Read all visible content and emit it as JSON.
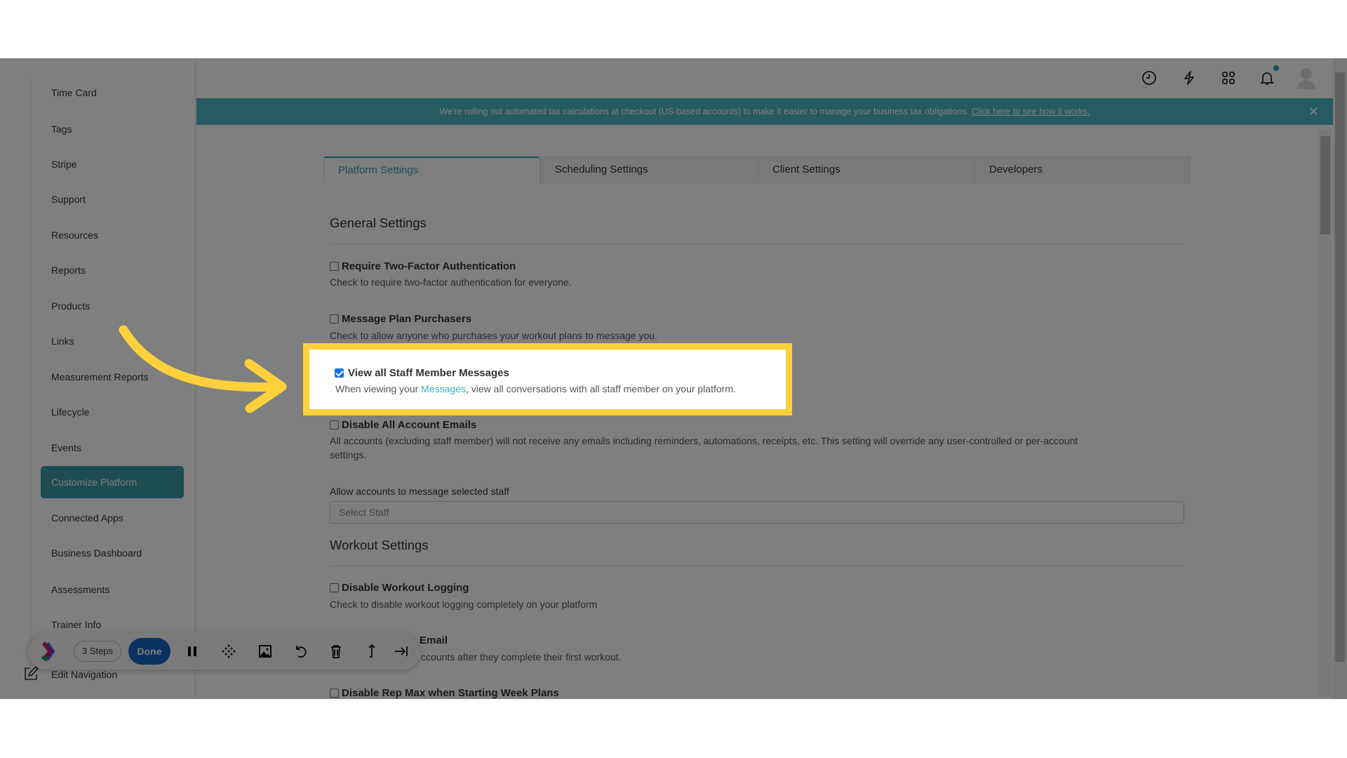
{
  "sidebar": {
    "items": [
      "Time Card",
      "Tags",
      "Stripe",
      "Support",
      "Resources",
      "Reports",
      "Products",
      "Links",
      "Measurement Reports",
      "Lifecycle",
      "Events",
      "Customize Platform",
      "Connected Apps",
      "Business Dashboard",
      "Assessments",
      "Trainer Info"
    ],
    "active": "Customize Platform",
    "edit_navigation": "Edit Navigation"
  },
  "header": {
    "icons": [
      "clock-icon",
      "bolt-icon",
      "apps-grid-icon",
      "bell-icon",
      "avatar"
    ],
    "notification_dot_color": "#2a9fb3"
  },
  "banner": {
    "text": "We're rolling out automated tax calculations at checkout (US-based accounts) to make it easier to manage your business tax obligations. ",
    "link": "Click here to see how it works.",
    "color": "#4fb7c6"
  },
  "tabs": [
    "Platform Settings",
    "Scheduling Settings",
    "Client Settings",
    "Developers"
  ],
  "active_tab": "Platform Settings",
  "general": {
    "heading": "General Settings",
    "items": [
      {
        "title": "Require Two-Factor Authentication",
        "desc": "Check to require two-factor authentication for everyone.",
        "checked": false
      },
      {
        "title": "Message Plan Purchasers",
        "desc": "Check to allow anyone who purchases your workout plans to message you.",
        "checked": false
      },
      {
        "title": "View all Staff Member Messages",
        "desc_before": "When viewing your ",
        "desc_link": "Messages",
        "desc_after": ", view all conversations with all staff member on your platform.",
        "checked": true
      },
      {
        "title": "Disable All Account Emails",
        "desc": "All accounts (excluding staff member) will not receive any emails including reminders, automations, receipts, etc. This setting will override any user-controlled or per-account",
        "desc2": "settings.",
        "checked": false
      }
    ],
    "staff_label": "Allow accounts to message selected staff",
    "staff_placeholder": "Select Staff"
  },
  "workout": {
    "heading": "Workout Settings",
    "items": [
      {
        "title": "Disable Workout Logging",
        "desc": "Check to disable workout logging completely on your platform",
        "checked": false
      },
      {
        "title_visible": "Email",
        "desc_visible": "ccounts after they complete their first workout."
      },
      {
        "title": "Disable Rep Max when Starting Week Plans",
        "checked": false
      }
    ]
  },
  "toolbar": {
    "steps": "3 Steps",
    "done": "Done",
    "done_color": "#1565c0"
  },
  "highlight_color": "#fdd03c"
}
